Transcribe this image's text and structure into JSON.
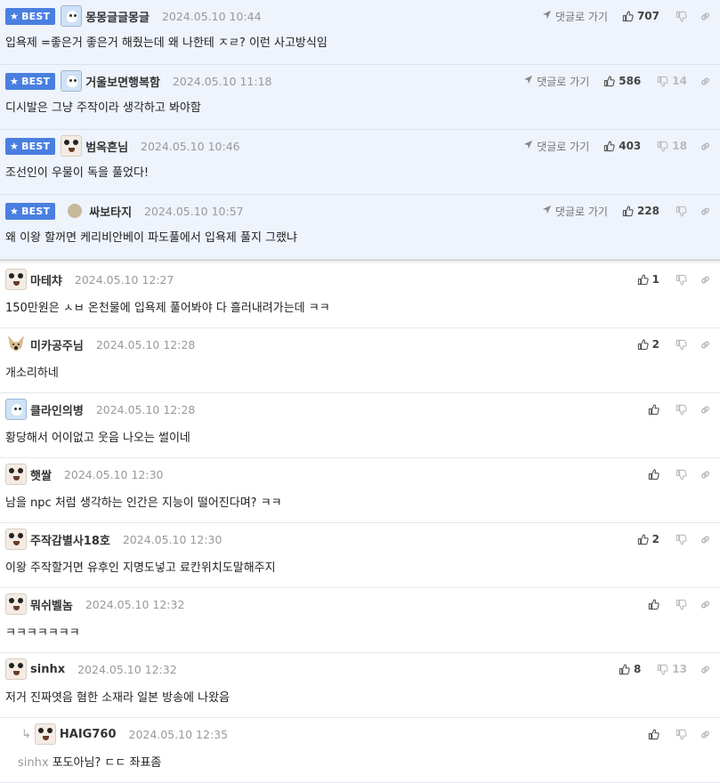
{
  "labels": {
    "best": "BEST",
    "goto": "댓글로 가기"
  },
  "colors": {
    "best_badge": "#4a7fe0",
    "best_bg": "#eef3fc"
  },
  "best_comments": [
    {
      "avatar": "blue-character-icon",
      "nick": "몽몽글글몽글",
      "date": "2024.05.10 10:44",
      "likes": "707",
      "dislikes": "",
      "text": "입욕제 =좋은거 좋은거 해줬는데 왜 나한테 ㅈㄹ? 이런 사고방식임"
    },
    {
      "avatar": "blue-character-icon",
      "nick": "거울보면행복함",
      "date": "2024.05.10 11:18",
      "likes": "586",
      "dislikes": "14",
      "text": "디시발은 그냥 주작이라 생각하고 봐야함"
    },
    {
      "avatar": "dog-character-icon",
      "nick": "범옥흔님",
      "date": "2024.05.10 10:46",
      "likes": "403",
      "dislikes": "18",
      "text": "조선인이 우물이 독을 풀었다!"
    },
    {
      "avatar": "default-dot-icon",
      "nick": "싸보타지",
      "date": "2024.05.10 10:57",
      "likes": "228",
      "dislikes": "",
      "text": "왜 이왕 할꺼면 케리비안베이 파도풀에서 입욕제 풀지 그랬냐"
    }
  ],
  "comments": [
    {
      "avatar": "dog-character-icon",
      "nick": "마테챠",
      "date": "2024.05.10 12:27",
      "likes": "1",
      "dislikes": "",
      "text": "150만원은 ㅅㅂ 온천물에 입욕제 풀어봐야 다 흘러내려가는데 ㅋㅋ",
      "reply": false,
      "mention": ""
    },
    {
      "avatar": "fox-character-icon",
      "nick": "미카공주님",
      "date": "2024.05.10 12:28",
      "likes": "2",
      "dislikes": "",
      "text": "개소리하네",
      "reply": false,
      "mention": ""
    },
    {
      "avatar": "blue-character-icon",
      "nick": "클라인의병",
      "date": "2024.05.10 12:28",
      "likes": "",
      "dislikes": "",
      "text": "황당해서 어이없고 웃음 나오는 썰이네",
      "reply": false,
      "mention": ""
    },
    {
      "avatar": "dog-character-icon",
      "nick": "햇쌀",
      "date": "2024.05.10 12:30",
      "likes": "",
      "dislikes": "",
      "text": "남을 npc 처럼 생각하는 인간은 지능이 떨어진다며? ㅋㅋ",
      "reply": false,
      "mention": ""
    },
    {
      "avatar": "dog-character-icon",
      "nick": "주작감별사18호",
      "date": "2024.05.10 12:30",
      "likes": "2",
      "dislikes": "",
      "text": "이왕 주작할거면 유후인 지명도넣고 료칸위치도말해주지",
      "reply": false,
      "mention": ""
    },
    {
      "avatar": "dog-character-icon",
      "nick": "뭐쉬벨놈",
      "date": "2024.05.10 12:32",
      "likes": "",
      "dislikes": "",
      "text": "ㅋㅋㅋㅋㅋㅋㅋ",
      "reply": false,
      "mention": ""
    },
    {
      "avatar": "dog-character-icon",
      "nick": "sinhx",
      "date": "2024.05.10 12:32",
      "likes": "8",
      "dislikes": "13",
      "text": "저거 진짜엿음 혐한 소재라 일본 방송에 나왔음",
      "reply": false,
      "mention": ""
    },
    {
      "avatar": "dog-character-icon",
      "nick": "HAIG760",
      "date": "2024.05.10 12:35",
      "likes": "",
      "dislikes": "",
      "text": "포도아님? ㄷㄷ 좌표좀",
      "reply": true,
      "mention": "sinhx"
    }
  ]
}
